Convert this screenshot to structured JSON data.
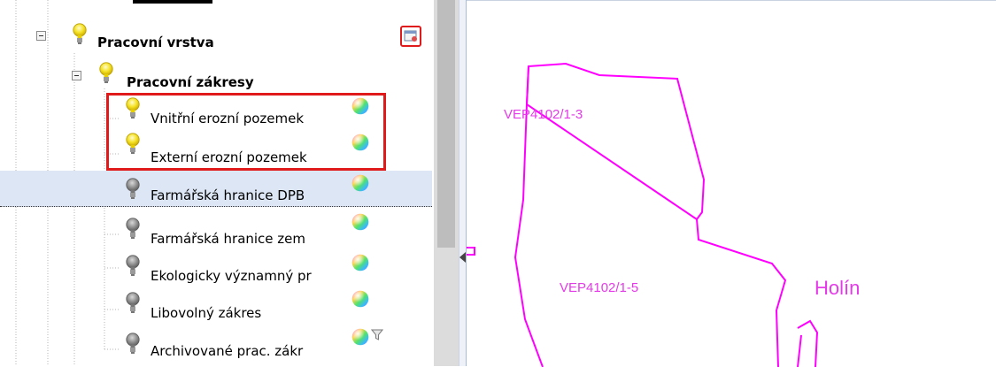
{
  "layer_tree": {
    "groups": [
      {
        "label": "Pracovní vrstva",
        "expanded": true,
        "subgroups": [
          {
            "label": "Pracovní zákresy",
            "expanded": true,
            "layers": [
              {
                "label": "Vnitřní erozní pozemek",
                "visible": true,
                "highlighted": true
              },
              {
                "label": "Externí erozní pozemek",
                "visible": true,
                "highlighted": true
              },
              {
                "label": "Farmářská hranice DPB",
                "visible": false,
                "selected": true
              },
              {
                "label": "Farmářská hranice zem",
                "visible": false
              },
              {
                "label": "Ekologicky významný pr",
                "visible": false
              },
              {
                "label": "Libovolný zákres",
                "visible": false
              },
              {
                "label": "Archivované prac. zákr",
                "visible": false,
                "has_filter": true
              }
            ]
          }
        ]
      }
    ]
  },
  "map": {
    "labels": [
      "VEP4102/1-3",
      "VEP4102/1-5",
      "Holín"
    ],
    "outline_color": "#ff00ff",
    "label_color": "#e43be8"
  },
  "colors": {
    "highlight": "#e0191b",
    "selection": "#dde6f4",
    "bulb_on": "#f5e223",
    "bulb_off": "#8c8c8c"
  },
  "icons": {
    "expander": "minus-square-icon",
    "layer_visibility": "lightbulb-icon",
    "style": "color-ball-icon",
    "filter": "funnel-icon",
    "group_settings": "layer-settings-icon"
  }
}
